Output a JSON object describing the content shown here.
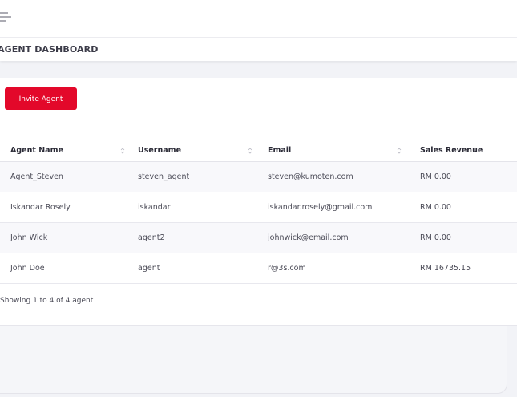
{
  "header": {
    "menu_icon": "hamburger-menu-icon",
    "page_title": "AGENT DASHBOARD"
  },
  "actions": {
    "invite_label": "Invite Agent",
    "invite_color": "#e3082a"
  },
  "table": {
    "columns": [
      {
        "label": "Agent Name",
        "sortable": true
      },
      {
        "label": "Username",
        "sortable": true
      },
      {
        "label": "Email",
        "sortable": true
      },
      {
        "label": "Sales Revenue",
        "sortable": false
      }
    ],
    "rows": [
      {
        "name": "Agent_Steven",
        "username": "steven_agent",
        "email": "steven@kumoten.com",
        "revenue": "RM 0.00"
      },
      {
        "name": "Iskandar Rosely",
        "username": "iskandar",
        "email": "iskandar.rosely@gmail.com",
        "revenue": "RM 0.00"
      },
      {
        "name": "John Wick",
        "username": "agent2",
        "email": "johnwick@email.com",
        "revenue": "RM 0.00"
      },
      {
        "name": "John Doe",
        "username": "agent",
        "email": "r@3s.com",
        "revenue": "RM 16735.15"
      }
    ],
    "info": "Showing 1 to 4 of 4 agent"
  }
}
